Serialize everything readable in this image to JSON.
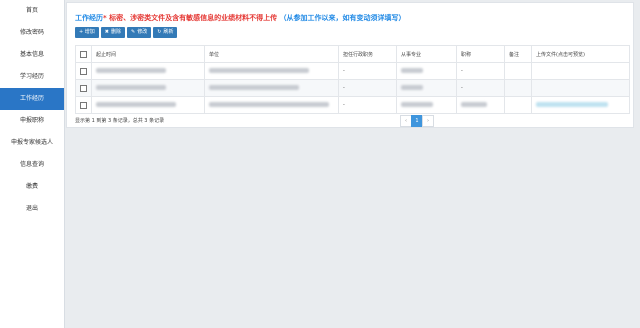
{
  "sidebar": {
    "items": [
      {
        "label": "首页"
      },
      {
        "label": "修改密码"
      },
      {
        "label": "基本信息"
      },
      {
        "label": "学习经历"
      },
      {
        "label": "工作经历"
      },
      {
        "label": "申报职称"
      },
      {
        "label": "申报专家候选人"
      },
      {
        "label": "信息查询"
      },
      {
        "label": "缴费"
      },
      {
        "label": "退出"
      }
    ]
  },
  "main": {
    "heading": {
      "prefix": "工作经历",
      "star": "*",
      "warning": "标密、涉密类文件及含有敏感信息的业绩材料不得上传",
      "note": "（从参加工作以来，如有变动须详填写）"
    },
    "toolbar": {
      "add": "+ 增加",
      "delete": "删除",
      "edit": "修改",
      "refresh": "刷新"
    },
    "table": {
      "columns": [
        "起止时间",
        "单位",
        "担任行政职务",
        "从事专业",
        "职称",
        "备注",
        "上传文件(点击可预览)"
      ],
      "rows": [
        {
          "duty": "-",
          "title": "-"
        },
        {
          "duty": "-",
          "title": "-"
        },
        {
          "duty": "-",
          "title": ""
        }
      ]
    },
    "summary": "显示第 1 到第 3 条记录，总共 3 条记录",
    "pagination": {
      "prev": "‹",
      "current": "1",
      "next": "›"
    }
  }
}
